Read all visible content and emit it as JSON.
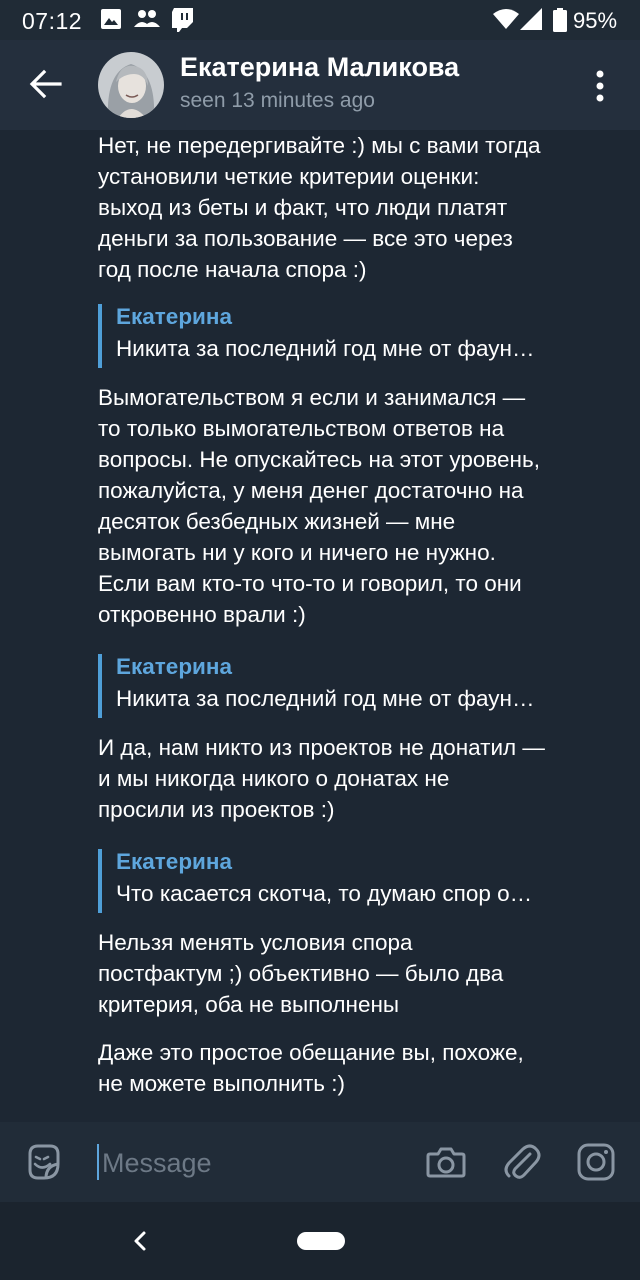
{
  "status_bar": {
    "time": "07:12",
    "battery": "95%",
    "icons": [
      "gallery-icon",
      "people-icon",
      "twitch-icon",
      "wifi-icon",
      "signal-icon",
      "battery-icon"
    ]
  },
  "header": {
    "contact_name": "Екатерина Маликова",
    "last_seen": "seen 13 minutes ago"
  },
  "messages": [
    {
      "type": "text",
      "text": "Нет, не передергивайте :) мы с вами тогда\nустановили четкие критерии оценки:\nвыход из беты и факт, что люди платят\nденьги за пользование — все это через\nгод после начала спора :)"
    },
    {
      "type": "reply",
      "author": "Екатерина",
      "text": "Никита за последний год мне от фаун…"
    },
    {
      "type": "text",
      "text": "Вымогательством я если и занимался —\nто только вымогательством ответов на\nвопросы. Не опускайтесь на этот уровень,\nпожалуйста, у меня денег достаточно на\nдесяток безбедных жизней — мне\nвымогать ни у кого и ничего не нужно.\nЕсли вам кто-то что-то и говорил, то они\nоткровенно врали :)"
    },
    {
      "type": "reply",
      "author": "Екатерина",
      "text": "Никита за последний год мне от фаун…"
    },
    {
      "type": "text",
      "text": "И да, нам никто из проектов не донатил —\nи мы никогда никого о донатах не\nпросили из проектов :)"
    },
    {
      "type": "reply",
      "author": "Екатерина",
      "text": "Что касается скотча, то думаю спор о…"
    },
    {
      "type": "text",
      "text": "Нельзя менять условия спора\nпостфактум ;) объективно — было два\nкритерия, оба не выполнены"
    },
    {
      "type": "text",
      "text": "Даже это простое обещание вы, похоже,\nне можете выполнить :)"
    }
  ],
  "input": {
    "placeholder": "Message"
  },
  "colors": {
    "background": "#1d2733",
    "header": "#242f3d",
    "accent": "#5ea6dd",
    "text": "#ffffff",
    "secondary_text": "#8f9ca9"
  }
}
